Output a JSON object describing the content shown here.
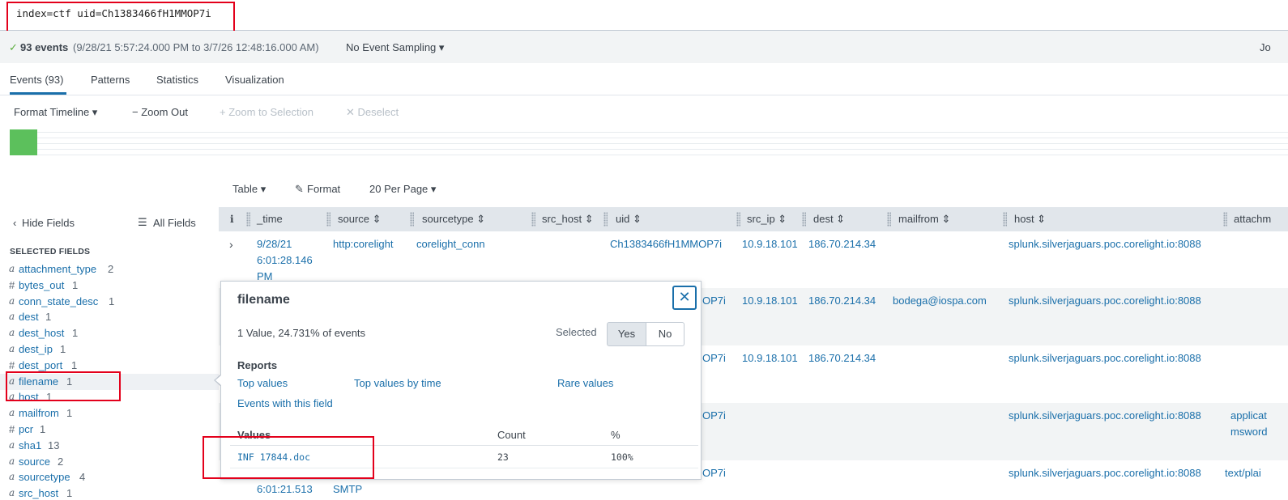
{
  "search": {
    "query": "index=ctf uid=Ch1383466fH1MMOP7i"
  },
  "status": {
    "check_icon": "check-icon",
    "count": "93 events",
    "range": "(9/28/21 5:57:24.000 PM to 3/7/26 12:48:16.000 AM)",
    "sampling": "No Event Sampling ▾",
    "job": "Jo"
  },
  "tabs": [
    "Events (93)",
    "Patterns",
    "Statistics",
    "Visualization"
  ],
  "timeline_toolbar": {
    "format": "Format Timeline ▾",
    "zoom_out": "− Zoom Out",
    "zoom_selection": "+ Zoom to Selection",
    "deselect": "✕ Deselect"
  },
  "results_toolbar": {
    "table": "Table ▾",
    "format": "Format",
    "per_page": "20 Per Page ▾"
  },
  "sidebar": {
    "hide_fields": "Hide Fields",
    "all_fields": "All Fields",
    "selected_heading": "SELECTED FIELDS",
    "fields": [
      {
        "type": "a",
        "name": "attachment_type",
        "count": "2"
      },
      {
        "type": "#",
        "name": "bytes_out",
        "count": "1"
      },
      {
        "type": "a",
        "name": "conn_state_desc",
        "count": "1"
      },
      {
        "type": "a",
        "name": "dest",
        "count": "1"
      },
      {
        "type": "a",
        "name": "dest_host",
        "count": "1"
      },
      {
        "type": "a",
        "name": "dest_ip",
        "count": "1"
      },
      {
        "type": "#",
        "name": "dest_port",
        "count": "1"
      },
      {
        "type": "a",
        "name": "filename",
        "count": "1"
      },
      {
        "type": "a",
        "name": "host",
        "count": "1"
      },
      {
        "type": "a",
        "name": "mailfrom",
        "count": "1"
      },
      {
        "type": "#",
        "name": "pcr",
        "count": "1"
      },
      {
        "type": "a",
        "name": "sha1",
        "count": "13"
      },
      {
        "type": "a",
        "name": "source",
        "count": "2"
      },
      {
        "type": "a",
        "name": "sourcetype",
        "count": "4"
      },
      {
        "type": "a",
        "name": "src_host",
        "count": "1"
      }
    ]
  },
  "table": {
    "info_col": "i",
    "headers": [
      "_time",
      "source ⇕",
      "sourcetype ⇕",
      "src_host ⇕",
      "uid ⇕",
      "src_ip ⇕",
      "dest ⇕",
      "mailfrom ⇕",
      "host ⇕",
      "attachm"
    ],
    "row1": {
      "time": [
        "9/28/21",
        "6:01:28.146",
        "PM"
      ],
      "source": "http:corelight",
      "sourcetype": "corelight_conn",
      "uid": "Ch1383466fH1MMOP7i",
      "src_ip": "10.9.18.101",
      "dest": "186.70.214.34",
      "host": "splunk.silverjaguars.poc.corelight.io:8088"
    },
    "row2": {
      "uid": "OP7i",
      "src_ip": "10.9.18.101",
      "dest": "186.70.214.34",
      "mailfrom": "bodega@iospa.com",
      "host": "splunk.silverjaguars.poc.corelight.io:8088"
    },
    "row3": {
      "uid": "OP7i",
      "src_ip": "10.9.18.101",
      "dest": "186.70.214.34",
      "host": "splunk.silverjaguars.poc.corelight.io:8088"
    },
    "row4": {
      "uid": "OP7i",
      "host": "splunk.silverjaguars.poc.corelight.io:8088",
      "attach1": "applicat",
      "attach2": "msword"
    },
    "row5": {
      "time": "6:01:21.513",
      "source": "SMTP",
      "uid": "OP7i",
      "host": "splunk.silverjaguars.poc.corelight.io:8088",
      "attach": "text/plai"
    }
  },
  "popover": {
    "title": "filename",
    "summary": "1 Value, 24.731% of events",
    "selected_label": "Selected",
    "yes": "Yes",
    "no": "No",
    "reports_heading": "Reports",
    "reports": [
      "Top values",
      "Top values by time",
      "Rare values",
      "Events with this field"
    ],
    "values_head": "Values",
    "count_head": "Count",
    "pct_head": "%",
    "rows": [
      {
        "value": "INF 17844.doc",
        "count": "23",
        "pct": "100%"
      }
    ],
    "close": "✕"
  },
  "colors": {
    "accent": "#1a6faa",
    "highlight_box": "#e3001b",
    "timeline_bar": "#5cc05c"
  }
}
